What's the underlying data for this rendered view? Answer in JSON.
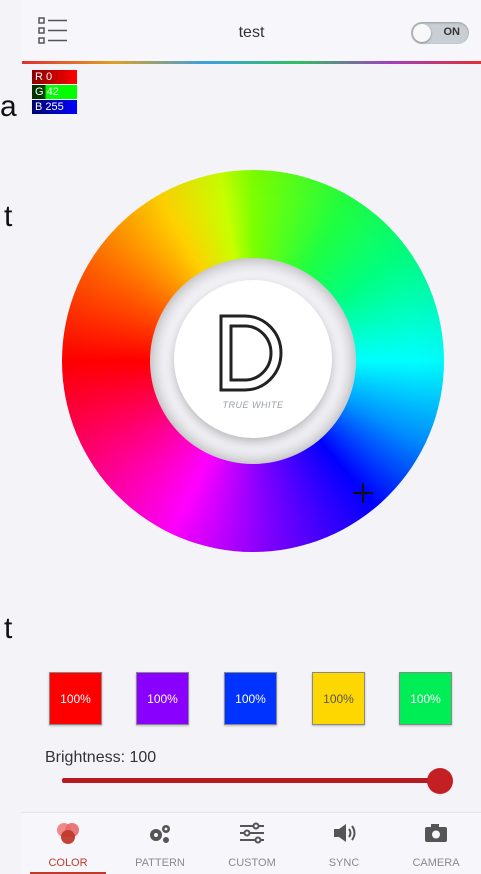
{
  "header": {
    "title": "test",
    "power": {
      "label": "ON",
      "state": "on"
    }
  },
  "rgb": {
    "r": "R 0",
    "g": "G 42",
    "b": "B 255"
  },
  "edge_text": {
    "top": "t",
    "bottom": "t"
  },
  "wheel": {
    "logo_letter": "D",
    "logo_text": "TRUE WHITE",
    "selector_icon": "crosshair-plus"
  },
  "presets": [
    {
      "label": "100%",
      "color": "#ff0000"
    },
    {
      "label": "100%",
      "color": "#8a00ff"
    },
    {
      "label": "100%",
      "color": "#0033ff"
    },
    {
      "label": "100%",
      "color": "#ffd700"
    },
    {
      "label": "100%",
      "color": "#00ee55"
    }
  ],
  "brightness": {
    "label": "Brightness: 100",
    "value": 100,
    "max": 100
  },
  "nav": {
    "items": [
      {
        "label": "COLOR",
        "icon": "color-circles-icon",
        "active": true
      },
      {
        "label": "PATTERN",
        "icon": "gears-icon",
        "active": false
      },
      {
        "label": "CUSTOM",
        "icon": "sliders-icon",
        "active": false
      },
      {
        "label": "SYNC",
        "icon": "speaker-icon",
        "active": false
      },
      {
        "label": "CAMERA",
        "icon": "camera-icon",
        "active": false
      }
    ]
  },
  "colors": {
    "accent": "#c41f25",
    "nav_active": "#c0392b"
  }
}
